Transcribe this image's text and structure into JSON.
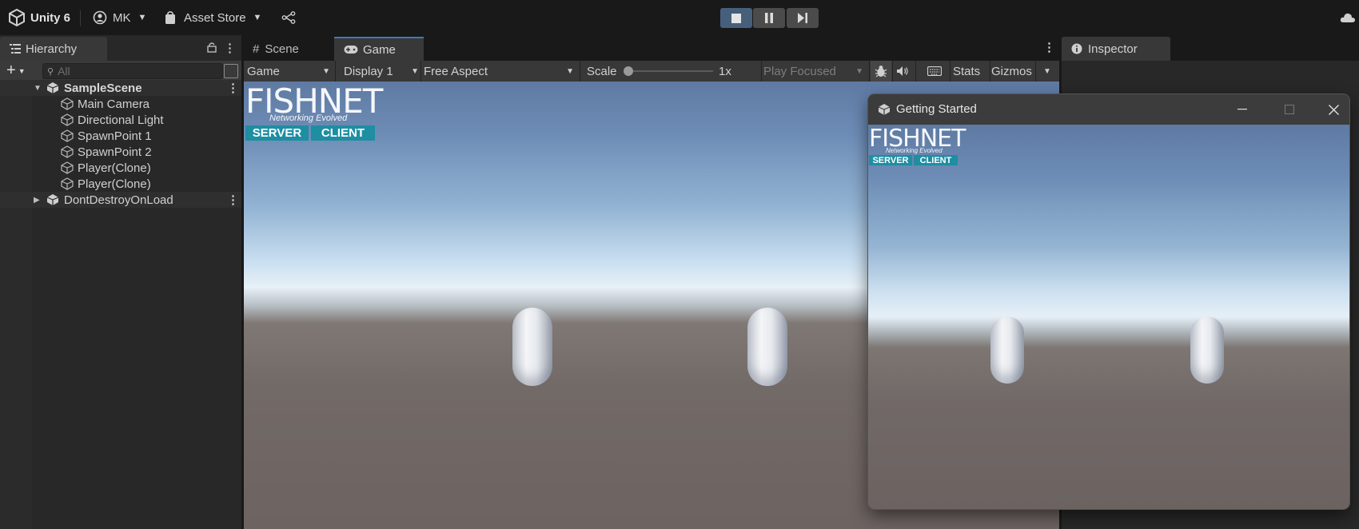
{
  "topbar": {
    "app_name": "Unity 6",
    "account": "MK",
    "asset_store": "Asset Store"
  },
  "hierarchy": {
    "tab_label": "Hierarchy",
    "search_placeholder": "All",
    "scene": "SampleScene",
    "objects": [
      "Main Camera",
      "Directional Light",
      "SpawnPoint 1",
      "SpawnPoint 2",
      "Player(Clone)",
      "Player(Clone)"
    ],
    "ddol": "DontDestroyOnLoad"
  },
  "center": {
    "tabs": [
      "Scene",
      "Game"
    ],
    "toolbar": {
      "mode": "Game",
      "display": "Display 1",
      "aspect": "Free Aspect",
      "scale_label": "Scale",
      "scale_value": "1x",
      "play_focused": "Play Focused",
      "stats": "Stats",
      "gizmos": "Gizmos"
    }
  },
  "logo": {
    "title": "FISHNET",
    "subtitle": "Networking Evolved",
    "server": "SERVER",
    "client": "CLIENT"
  },
  "inspector": {
    "tab_label": "Inspector"
  },
  "window": {
    "title": "Getting Started"
  },
  "colors": {
    "accent_blue": "#3a79bb",
    "play_active": "#46607c",
    "server_badge": "#1e8ea2",
    "client_badge": "#1e8ea2"
  }
}
